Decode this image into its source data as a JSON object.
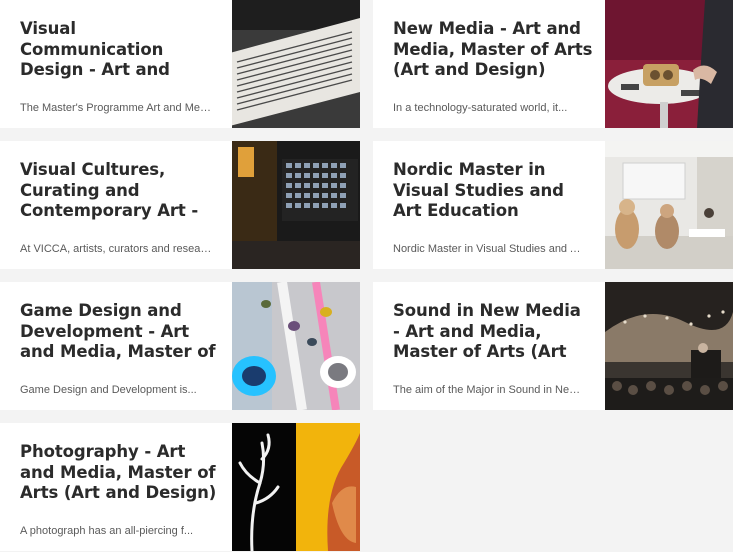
{
  "programmes": [
    {
      "title": "Visual Communication Design - Art and Media, Master of Arts",
      "description": "The Master's Programme Art and Media...",
      "image": "typewritten-paper-photo"
    },
    {
      "title": "New Media - Art and Media, Master of Arts (Art and Design)",
      "description": "In a technology-saturated world, it...",
      "image": "wooden-device-on-table-photo"
    },
    {
      "title": "Visual Cultures, Curating and Contemporary Art - Art",
      "description": "At VICCA, artists, curators and researchers...",
      "image": "gallery-wall-photo"
    },
    {
      "title": "Nordic Master in Visual Studies and Art Education (NoVA),",
      "description": "Nordic Master in Visual Studies and Art...",
      "image": "seminar-room-photo"
    },
    {
      "title": "Game Design and Development - Art and Media, Master of Arts",
      "description": "Game Design and Development is...",
      "image": "climbing-wall-lights-photo"
    },
    {
      "title": "Sound in New Media - Art and Media, Master of Arts (Art and",
      "description": "The aim of the Major in Sound in New Media...",
      "image": "concert-hall-photo"
    },
    {
      "title": "Photography - Art and Media, Master of Arts (Art and Design)",
      "description": "A photograph has an all-piercing f...",
      "image": "branch-and-portrait-photo"
    }
  ]
}
